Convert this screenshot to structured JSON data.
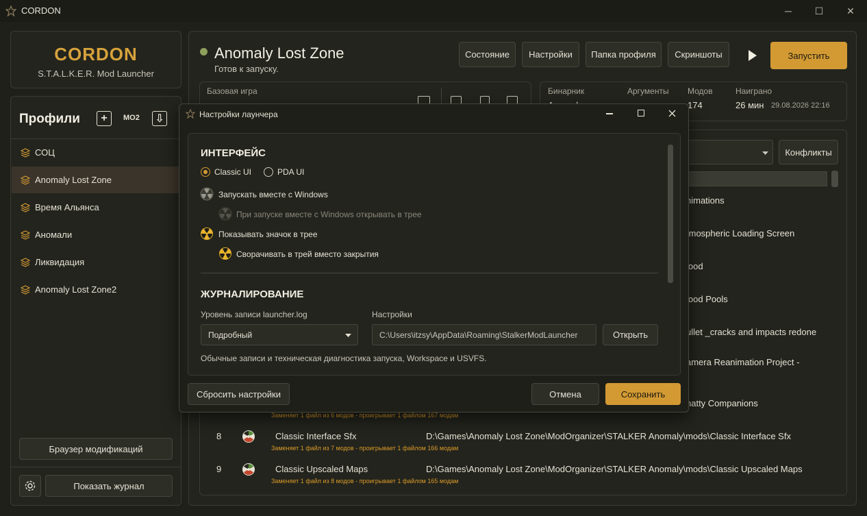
{
  "window": {
    "title": "CORDON",
    "minimize": "─",
    "maximize": "☐",
    "close": "✕"
  },
  "brand": {
    "name": "CORDON",
    "subtitle": "S.T.A.L.K.E.R. Mod Launcher"
  },
  "sidebar": {
    "header": "Профили",
    "add_icon": "+",
    "mo2_label": "MO2",
    "import_icon": "⇩",
    "profiles": [
      {
        "label": "СОЦ"
      },
      {
        "label": "Anomaly Lost Zone"
      },
      {
        "label": "Время Альянса"
      },
      {
        "label": "Аномали"
      },
      {
        "label": "Ликвидация"
      },
      {
        "label": "Anomaly Lost Zone2"
      }
    ],
    "mods_browser_button": "Браузер модификаций",
    "show_log_button": "Показать журнал"
  },
  "header": {
    "title": "Anomaly Lost Zone",
    "status": "Готов к запуску.",
    "buttons": {
      "state": "Состояние",
      "settings": "Настройки",
      "profile_folder": "Папка профиля",
      "screenshots": "Скриншоты",
      "launch": "Запустить"
    }
  },
  "base_game": {
    "label": "Базовая игра"
  },
  "stats": {
    "binary_label": "Бинарник",
    "binary_value": "Anomaly...",
    "args_label": "Аргументы",
    "mods_label": "Модов",
    "mods_value": "174",
    "played_label": "Наиграно",
    "played_value": "26 мин",
    "played_date": "29.08.2026 22:16"
  },
  "conflicts_button": "Конфликты",
  "mod_list_partial": [
    "nimations",
    "tmospheric Loading Screen",
    "lood",
    "lood Pools",
    "ullet _cracks and impacts redone",
    "amera Reanimation Project -",
    "hatty Companions"
  ],
  "mods": [
    {
      "num": "8",
      "name": "Classic Interface Sfx",
      "path": "D:\\Games\\Anomaly Lost Zone\\ModOrganizer\\STALKER Anomaly\\mods\\Classic Interface Sfx",
      "note": "Заменяет 1 файл из 7 модов - проигрывает 1 файлом 166 модам"
    },
    {
      "num": "9",
      "name": "Classic Upscaled Maps",
      "path": "D:\\Games\\Anomaly Lost Zone\\ModOrganizer\\STALKER Anomaly\\mods\\Classic Upscaled Maps",
      "note": "Заменяет 1 файл из 8 модов - проигрывает 1 файлом 165 модам"
    }
  ],
  "partial_note": "Заменяет 1 файл из 6 модов - проигрывает 1 файлом 167 модам",
  "dialog": {
    "title": "Настройки лаунчера",
    "interface_header": "ИНТЕРФЕЙС",
    "classic_ui": "Classic UI",
    "pda_ui": "PDA UI",
    "autostart": "Запускать вместе с Windows",
    "autostart_tray": "При запуске вместе с Windows открывать в трее",
    "show_tray_icon": "Показывать значок в трее",
    "minimize_to_tray": "Сворачивать в трей вместо закрытия",
    "logging_header": "ЖУРНАЛИРОВАНИЕ",
    "log_level_label": "Уровень записи launcher.log",
    "log_level_value": "Подробный",
    "settings_label": "Настройки",
    "settings_path": "C:\\Users\\itzsy\\AppData\\Roaming\\StalkerModLauncher",
    "open_button": "Открыть",
    "log_hint": "Обычные записи и техническая диагностика запуска, Workspace и USVFS.",
    "reset_button": "Сбросить настройки",
    "cancel_button": "Отмена",
    "save_button": "Сохранить"
  }
}
